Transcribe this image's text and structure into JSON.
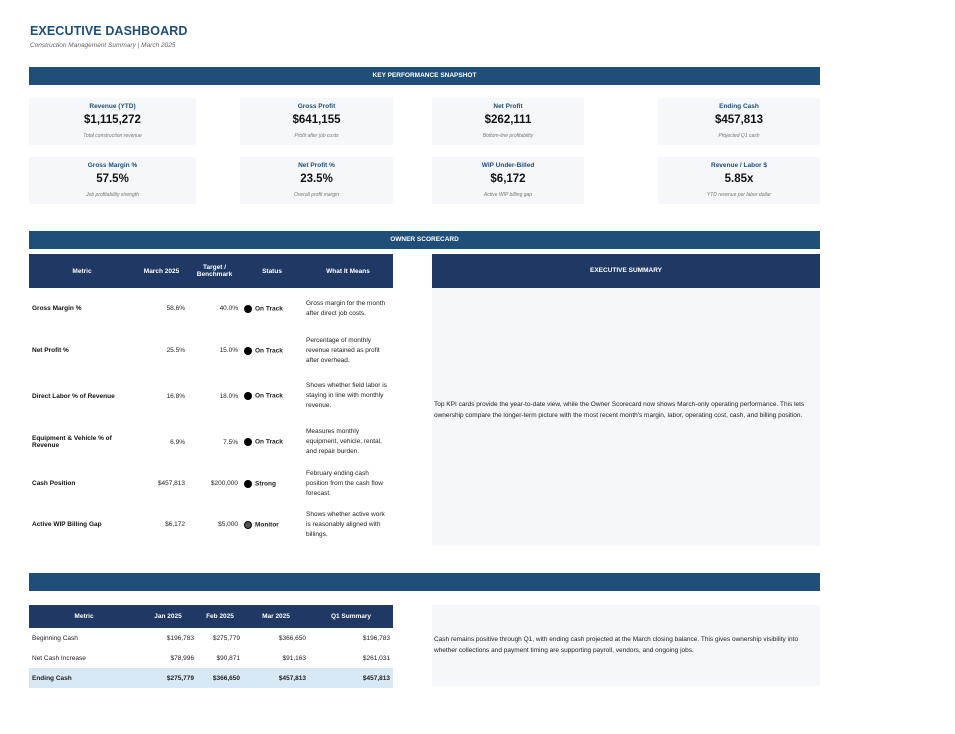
{
  "header": {
    "title": "EXECUTIVE DASHBOARD",
    "subtitle": "Construction Management Summary | March 2025"
  },
  "kpi_section_title": "KEY PERFORMANCE SNAPSHOT",
  "kpis": [
    {
      "label": "Revenue (YTD)",
      "value": "$1,115,272",
      "caption": "Total construction revenue"
    },
    {
      "label": "Gross Profit",
      "value": "$641,155",
      "caption": "Profit after job costs"
    },
    {
      "label": "Net Profit",
      "value": "$262,111",
      "caption": "Bottom-line profitability"
    },
    {
      "label": "Ending Cash",
      "value": "$457,813",
      "caption": "Projected Q1 cash"
    },
    {
      "label": "Gross Margin %",
      "value": "57.5%",
      "caption": "Job profitability strength"
    },
    {
      "label": "Net Profit %",
      "value": "23.5%",
      "caption": "Overall profit margin"
    },
    {
      "label": "WIP Under-Billed",
      "value": "$6,172",
      "caption": "Active WIP billing gap"
    },
    {
      "label": "Revenue / Labor $",
      "value": "5.85x",
      "caption": "YTD revenue per labor dollar"
    }
  ],
  "scorecard": {
    "section_title": "OWNER SCORECARD",
    "headers": [
      "Metric",
      "March 2025",
      "Target / Benchmark",
      "Status",
      "What It Means"
    ],
    "rows": [
      {
        "metric": "Gross Margin %",
        "value": "58.6%",
        "target": "40.0%",
        "status": "On Track",
        "meaning": "Gross margin for the month after direct job costs."
      },
      {
        "metric": "Net Profit %",
        "value": "25.5%",
        "target": "15.0%",
        "status": "On Track",
        "meaning": "Percentage of monthly revenue retained as profit after overhead."
      },
      {
        "metric": "Direct Labor % of Revenue",
        "value": "16.8%",
        "target": "18.0%",
        "status": "On Track",
        "meaning": "Shows whether field labor is staying in line with monthly revenue."
      },
      {
        "metric": "Equipment & Vehicle % of Revenue",
        "value": "6.9%",
        "target": "7.5%",
        "status": "On Track",
        "meaning": "Measures monthly equipment, vehicle, rental, and repair burden."
      },
      {
        "metric": "Cash Position",
        "value": "$457,813",
        "target": "$200,000",
        "status": "Strong",
        "meaning": "February ending cash position from the cash flow forecast."
      },
      {
        "metric": "Active WIP Billing Gap",
        "value": "$6,172",
        "target": "$5,000",
        "status": "Monitor",
        "meaning": "Shows whether active work is reasonably aligned with billings."
      }
    ]
  },
  "executive_summary": {
    "title": "EXECUTIVE SUMMARY",
    "text": "Top KPI cards provide the year-to-date view, while the Owner Scorecard now shows March-only operating performance. This lets ownership compare the longer-term picture with the most recent month's margin, labor, operating cost, cash, and billing position."
  },
  "cash_flow": {
    "section_title": "",
    "headers": [
      "Metric",
      "Jan 2025",
      "Feb 2025",
      "Mar 2025",
      "Q1 Summary"
    ],
    "rows": [
      {
        "metric": "Beginning Cash",
        "jan": "$196,783",
        "feb": "$275,779",
        "mar": "$366,650",
        "q1": "$196,783"
      },
      {
        "metric": "Net Cash Increase",
        "jan": "$78,996",
        "feb": "$90,871",
        "mar": "$91,163",
        "q1": "$261,031"
      },
      {
        "metric": "Ending Cash",
        "jan": "$275,779",
        "feb": "$366,650",
        "mar": "$457,813",
        "q1": "$457,813"
      }
    ],
    "note": "Cash remains positive through Q1, with ending cash projected at the March closing balance. This gives ownership visibility into whether collections and payment timing are supporting payroll, vendors, and ongoing jobs."
  },
  "colors": {
    "band": "#1f4e79",
    "table_header": "#1f3864",
    "card_bg": "#f5f7fa",
    "highlight_row": "#d9e8f5"
  }
}
